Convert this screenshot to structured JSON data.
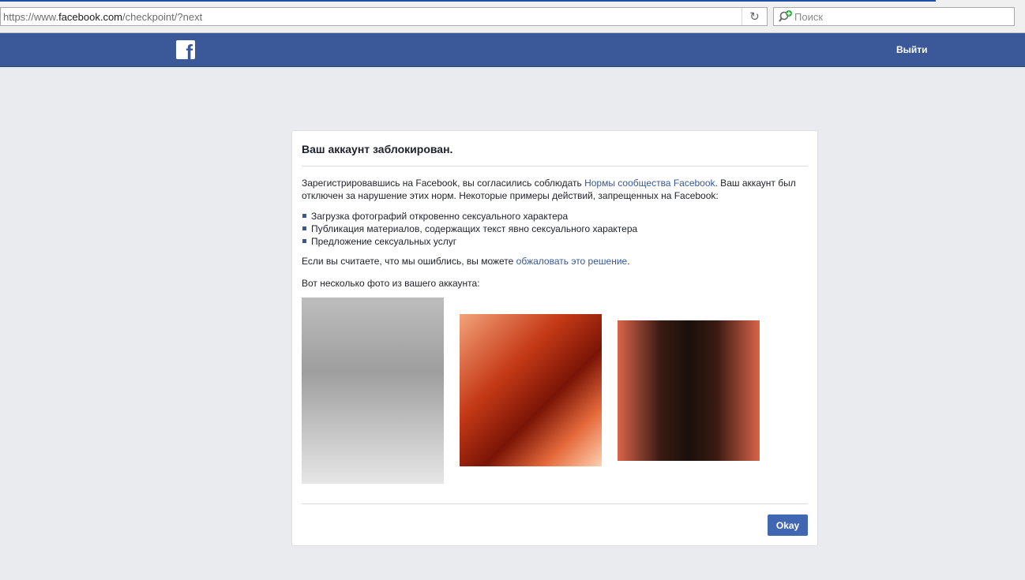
{
  "browser": {
    "url_prefix": "https://www.",
    "url_domain": "facebook.com",
    "url_path": "/checkpoint/?next",
    "reload_icon": "reload-icon",
    "search_placeholder": "Поиск",
    "search_icon": "search-add-icon"
  },
  "header": {
    "logo_letter": "f",
    "logout_label": "Выйти"
  },
  "dialog": {
    "title": "Ваш аккаунт заблокирован.",
    "intro_before_link": "Зарегистрировавшись на Facebook, вы согласились соблюдать ",
    "intro_link": "Нормы сообщества Facebook",
    "intro_after_link": ". Ваш аккаунт был отключен за нарушение этих норм. Некоторые примеры действий, запрещенных на Facebook:",
    "violations": [
      "Загрузка фотографий откровенно сексуального характера",
      "Публикация материалов, содержащих текст явно сексуального характера",
      "Предложение сексуальных услуг"
    ],
    "appeal_before_link": "Если вы считаете, что мы ошиблись, вы можете ",
    "appeal_link": "обжаловать это решение",
    "appeal_after_link": ".",
    "photos_label": "Вот несколько фото из вашего аккаунта:",
    "okay_label": "Okay"
  }
}
